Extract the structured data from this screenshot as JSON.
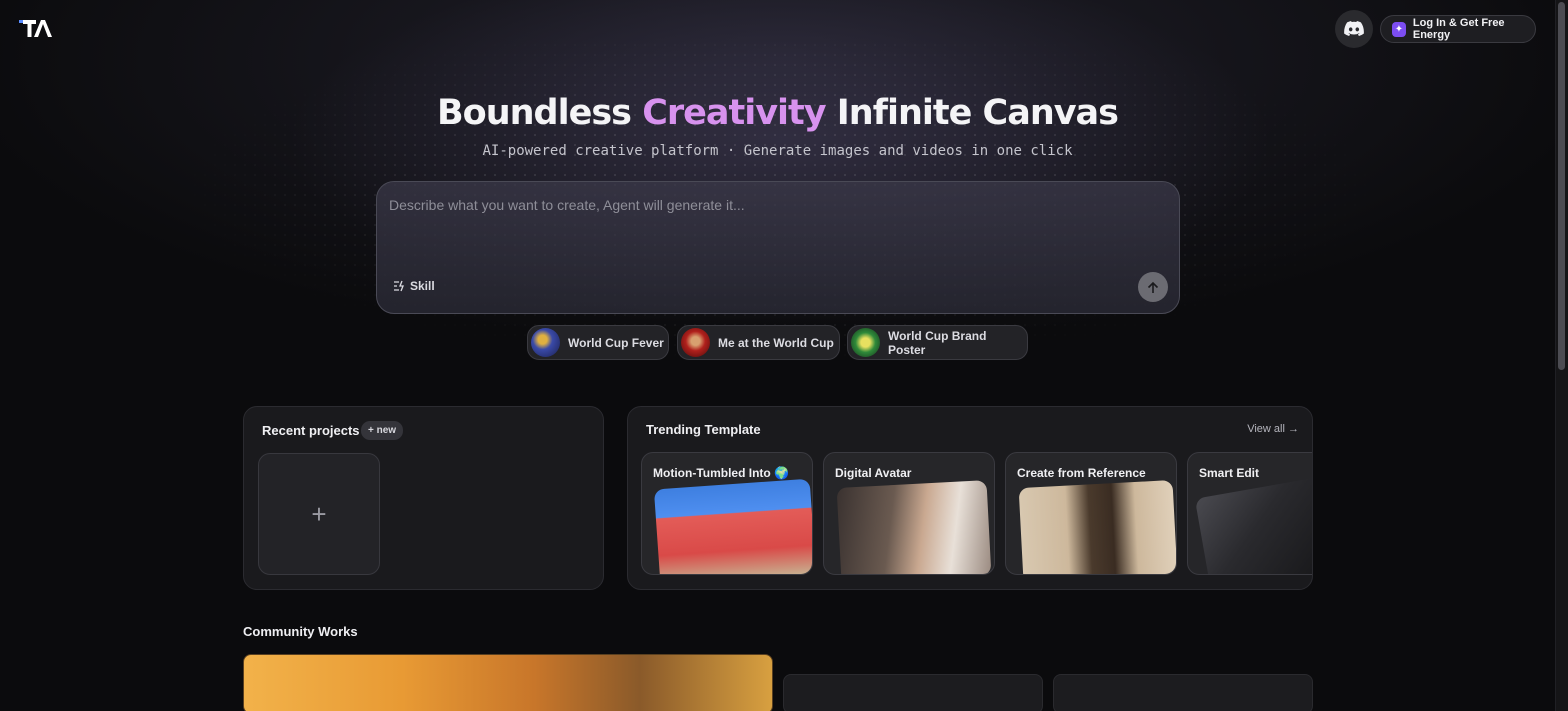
{
  "header": {
    "login_label": "Log In & Get Free Energy",
    "logo_icon": "ta-logo-icon",
    "discord_icon": "discord-icon"
  },
  "hero": {
    "title_part1": "Boundless ",
    "title_accent": "Creativity",
    "title_part2": " Infinite Canvas",
    "subtitle": "AI-powered creative platform · Generate images and videos in one click",
    "accent_color": "#d792ee"
  },
  "prompt": {
    "placeholder": "Describe what you want to create, Agent will generate it...",
    "skill_label": "Skill",
    "send_icon": "arrow-up-icon"
  },
  "chips": [
    {
      "label": "World Cup Fever"
    },
    {
      "label": "Me at the World Cup"
    },
    {
      "label": "World Cup Brand Poster"
    }
  ],
  "recent": {
    "title": "Recent projects",
    "new_label": "+ new",
    "add_icon": "+"
  },
  "trending": {
    "title": "Trending Template",
    "view_all": "View all",
    "templates": [
      {
        "label": "Motion-Tumbled Into 🌍"
      },
      {
        "label": "Digital Avatar"
      },
      {
        "label": "Create from Reference"
      },
      {
        "label": "Smart Edit"
      }
    ]
  },
  "community": {
    "title": "Community Works"
  }
}
